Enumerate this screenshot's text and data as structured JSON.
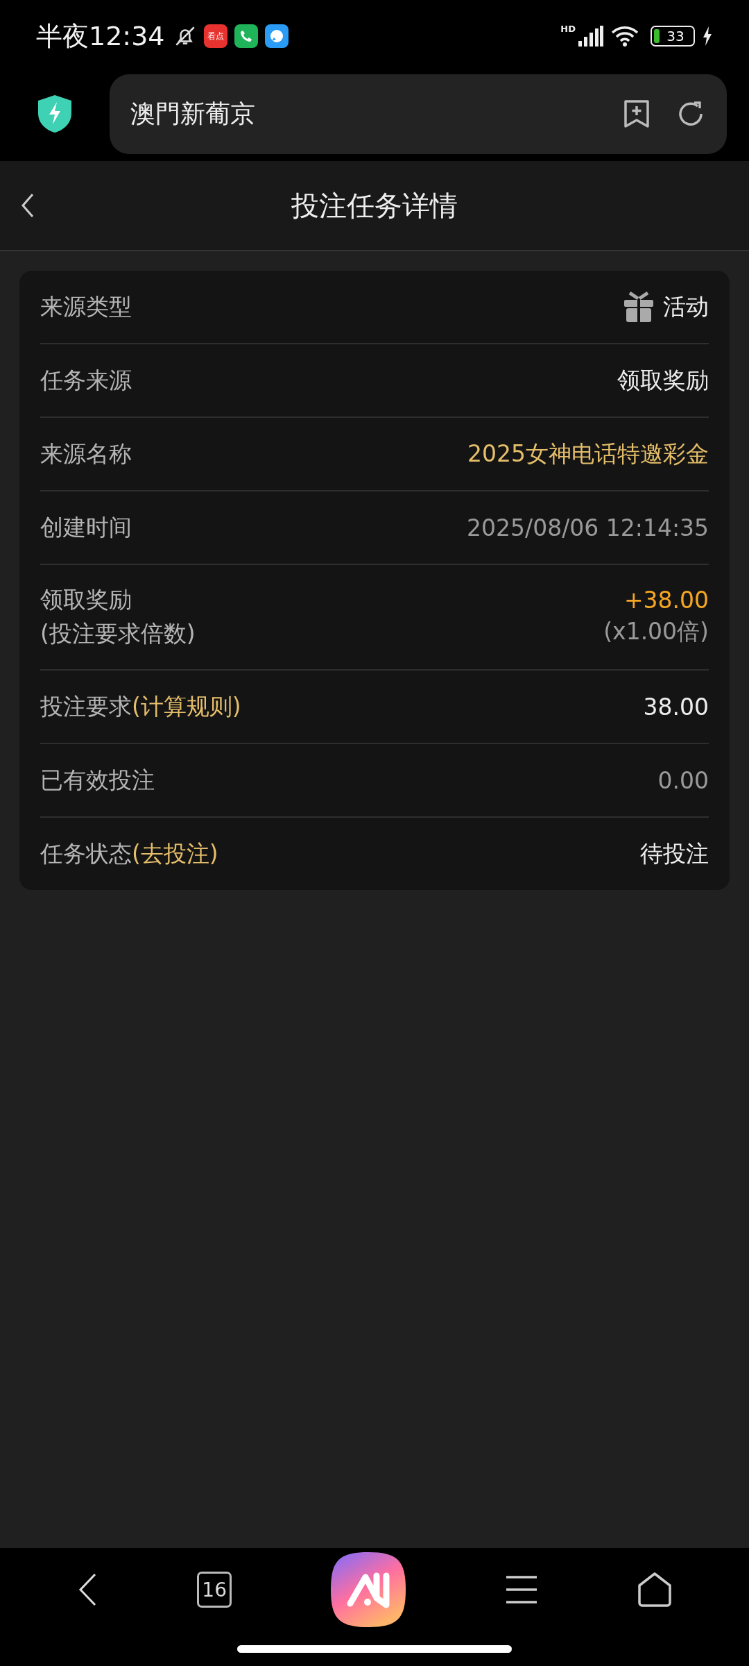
{
  "status_bar": {
    "time": "半夜12:34",
    "app_badge": "看点",
    "network": "HD",
    "battery": "33"
  },
  "address_bar": {
    "value": "澳門新葡京"
  },
  "header": {
    "title": "投注任务详情"
  },
  "rows": [
    {
      "kind": "icon",
      "label": "来源类型",
      "value": "活动",
      "color": "#eeeeee"
    },
    {
      "kind": "plain",
      "label": "任务来源",
      "value": "领取奖励",
      "color": "#eeeeee"
    },
    {
      "kind": "plain",
      "label": "来源名称",
      "value": "2025女神电话特邀彩金",
      "color": "#e5be6a"
    },
    {
      "kind": "plain",
      "label": "创建时间",
      "value": "2025/08/06 12:14:35",
      "color": "#9a9a9a"
    },
    {
      "kind": "double",
      "label": "领取奖励",
      "label_sub": "(投注要求倍数)",
      "value": "+38.00",
      "value_sub": "(x1.00倍)",
      "color": "#f5a623"
    },
    {
      "kind": "link",
      "label": "投注要求",
      "link": "(计算规则)",
      "value": "38.00",
      "color": "#eeeeee"
    },
    {
      "kind": "plain",
      "label": "已有效投注",
      "value": "0.00",
      "color": "#9a9a9a"
    },
    {
      "kind": "link",
      "label": "任务状态",
      "link": "(去投注)",
      "value": "待投注",
      "color": "#eeeeee"
    }
  ],
  "bottom_nav": {
    "tabs_count": "16"
  }
}
